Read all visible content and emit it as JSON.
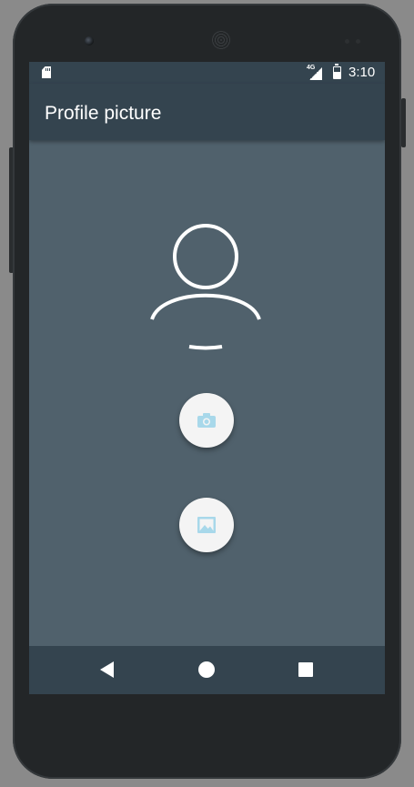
{
  "device": {
    "front_camera_icon": "front-camera",
    "speaker_grille_icon": "speaker-grille"
  },
  "status_bar": {
    "sd_card_icon": "sd-card-icon",
    "network_type": "4G",
    "signal_icon": "cell-signal-icon",
    "battery_icon": "battery-charging-icon",
    "time": "3:10"
  },
  "app_bar": {
    "title": "Profile picture"
  },
  "content": {
    "avatar_icon": "person-outline-icon",
    "actions": [
      {
        "icon": "camera-icon",
        "accent": "#a8d8ea"
      },
      {
        "icon": "image-icon",
        "accent": "#a8d8ea"
      }
    ]
  },
  "nav_bar": {
    "back_icon": "back-triangle-icon",
    "home_icon": "home-circle-icon",
    "recents_icon": "recents-square-icon"
  },
  "colors": {
    "screen_background": "#50616c",
    "bar_background": "#34444f",
    "fab_background": "#f4f4f4",
    "fab_icon": "#a8d8ea"
  }
}
